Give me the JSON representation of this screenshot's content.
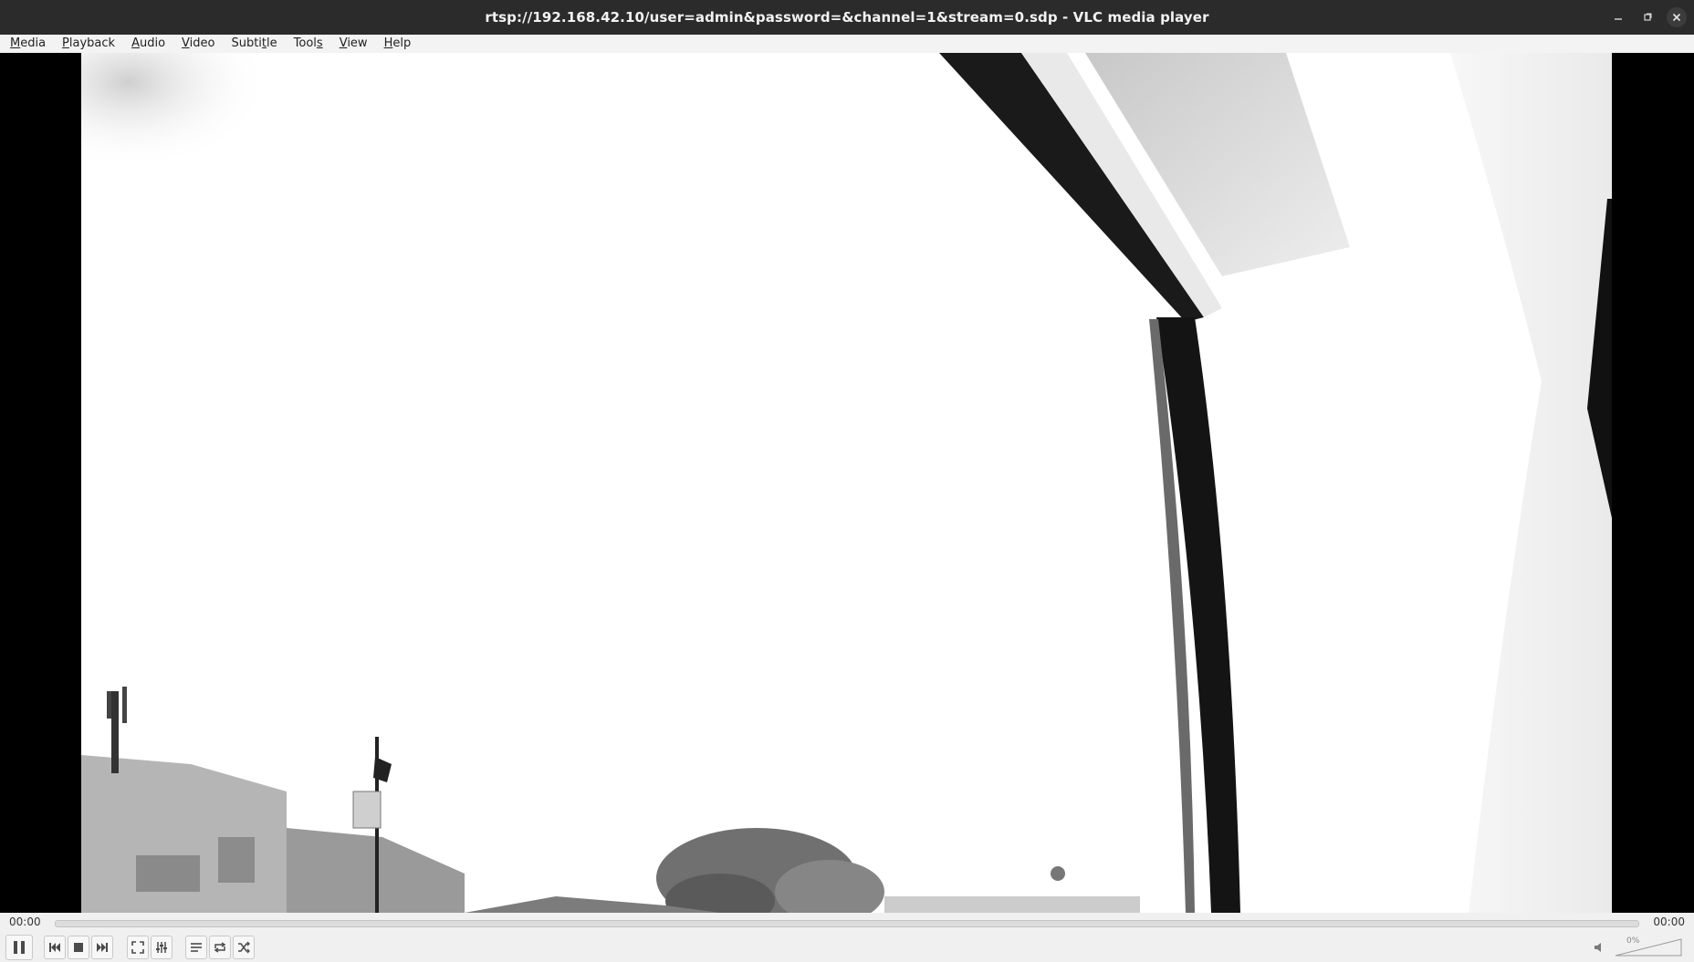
{
  "window": {
    "title": "rtsp://192.168.42.10/user=admin&password=&channel=1&stream=0.sdp - VLC media player"
  },
  "menubar": {
    "items": [
      {
        "label": "Media",
        "mnemonic": "M",
        "rest": "edia"
      },
      {
        "label": "Playback",
        "mnemonic": "P",
        "rest": "layback"
      },
      {
        "label": "Audio",
        "mnemonic": "A",
        "rest": "udio"
      },
      {
        "label": "Video",
        "mnemonic": "V",
        "rest": "ideo"
      },
      {
        "label": "Subtitle",
        "mnemonic": "",
        "pre": "Subti",
        "u": "t",
        "post": "le"
      },
      {
        "label": "Tools",
        "pre": "Tool",
        "u": "s",
        "post": ""
      },
      {
        "label": "View",
        "mnemonic": "V",
        "rest": "iew"
      },
      {
        "label": "Help",
        "mnemonic": "H",
        "rest": "elp"
      }
    ]
  },
  "player": {
    "elapsed": "00:00",
    "total": "00:00",
    "progress": 0.0,
    "volume_label": "0%",
    "volume": 0.0
  },
  "icons": {
    "minimize": "minimize-icon",
    "restore": "restore-icon",
    "close": "close-icon",
    "pause": "pause-icon",
    "previous": "previous-icon",
    "stop": "stop-icon",
    "next": "next-icon",
    "fullscreen": "fullscreen-icon",
    "extended_settings": "equalizer-icon",
    "playlist": "playlist-icon",
    "loop": "loop-icon",
    "shuffle": "shuffle-icon",
    "mute": "speaker-icon"
  },
  "colors": {
    "titlebar": "#2b2b2b",
    "menubar": "#f3f3f3",
    "video_background": "#000000",
    "controls_background": "#f0f0f0"
  }
}
